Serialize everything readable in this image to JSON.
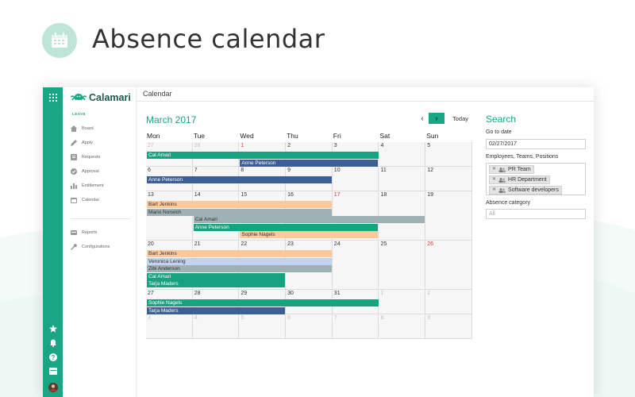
{
  "header": {
    "title": "Absence calendar"
  },
  "brand": {
    "name": "Calamari"
  },
  "sidebar": {
    "section_label": "LEAVE",
    "items": [
      {
        "label": "Board",
        "icon": "home-icon"
      },
      {
        "label": "Apply",
        "icon": "pencil-icon"
      },
      {
        "label": "Requests",
        "icon": "list-icon"
      },
      {
        "label": "Approval",
        "icon": "check-circle-icon"
      },
      {
        "label": "Entitlement",
        "icon": "bar-chart-icon"
      },
      {
        "label": "Calendar",
        "icon": "calendar-icon"
      }
    ],
    "bottom_items": [
      {
        "label": "Reports",
        "icon": "reports-icon"
      },
      {
        "label": "Configurations",
        "icon": "wrench-icon"
      }
    ]
  },
  "topbar": {
    "title": "Calendar"
  },
  "calendar": {
    "month_label": "March 2017",
    "today_label": "Today",
    "prev_label": "‹",
    "next_label": "›",
    "weekdays": [
      "Mon",
      "Tue",
      "Wed",
      "Thu",
      "Fri",
      "Sat",
      "Sun"
    ],
    "weeks": [
      [
        {
          "d": "27",
          "o": true
        },
        {
          "d": "28",
          "o": true
        },
        {
          "d": "1",
          "r": true
        },
        {
          "d": "2"
        },
        {
          "d": "3"
        },
        {
          "d": "4"
        },
        {
          "d": "5"
        }
      ],
      [
        {
          "d": "6"
        },
        {
          "d": "7"
        },
        {
          "d": "8"
        },
        {
          "d": "9"
        },
        {
          "d": "10"
        },
        {
          "d": "11"
        },
        {
          "d": "12"
        }
      ],
      [
        {
          "d": "13"
        },
        {
          "d": "14"
        },
        {
          "d": "15"
        },
        {
          "d": "16"
        },
        {
          "d": "17",
          "r": true
        },
        {
          "d": "18"
        },
        {
          "d": "19"
        }
      ],
      [
        {
          "d": "20"
        },
        {
          "d": "21"
        },
        {
          "d": "22"
        },
        {
          "d": "23"
        },
        {
          "d": "24"
        },
        {
          "d": "25"
        },
        {
          "d": "26",
          "r": true
        }
      ],
      [
        {
          "d": "27"
        },
        {
          "d": "28"
        },
        {
          "d": "29"
        },
        {
          "d": "30"
        },
        {
          "d": "31"
        },
        {
          "d": "1",
          "o": true
        },
        {
          "d": "2",
          "o": true
        }
      ],
      [
        {
          "d": "3",
          "o": true
        },
        {
          "d": "4",
          "o": true
        },
        {
          "d": "5",
          "o": true
        },
        {
          "d": "6",
          "o": true
        },
        {
          "d": "7",
          "o": true
        },
        {
          "d": "8",
          "o": true
        },
        {
          "d": "9",
          "o": true
        }
      ]
    ],
    "absences": [
      {
        "name": "Cal Amari",
        "week": 0,
        "slot": 0,
        "start": 0,
        "span": 5,
        "color": "#17a37f",
        "text": "#ffffff"
      },
      {
        "name": "Anne Peterson",
        "week": 0,
        "slot": 1,
        "start": 2,
        "span": 3,
        "color": "#3c5f95",
        "text": "#ffffff"
      },
      {
        "name": "Anne Peterson",
        "week": 1,
        "slot": 0,
        "start": 0,
        "span": 4,
        "color": "#3c5f95",
        "text": "#ffffff"
      },
      {
        "name": "Bart Jenkins",
        "week": 2,
        "slot": 0,
        "start": 0,
        "span": 4,
        "color": "#fdc89c",
        "text": "#333333"
      },
      {
        "name": "Mario Norwich",
        "week": 2,
        "slot": 1,
        "start": 0,
        "span": 4,
        "color": "#9fb1b4",
        "text": "#333333"
      },
      {
        "name": "Cal Amari",
        "week": 2,
        "slot": 2,
        "start": 1,
        "span": 5,
        "color": "#9fb1b4",
        "text": "#333333"
      },
      {
        "name": "Anne Peterson",
        "week": 2,
        "slot": 3,
        "start": 1,
        "span": 4,
        "color": "#17a37f",
        "text": "#ffffff"
      },
      {
        "name": "Sophie Nagels",
        "week": 2,
        "slot": 4,
        "start": 2,
        "span": 3,
        "color": "#fdc89c",
        "text": "#333333"
      },
      {
        "name": "Bart Jenkins",
        "week": 3,
        "slot": 0,
        "start": 0,
        "span": 4,
        "color": "#fdc89c",
        "text": "#333333"
      },
      {
        "name": "Veronica Lening",
        "week": 3,
        "slot": 1,
        "start": 0,
        "span": 4,
        "color": "#c3d2ee",
        "text": "#333333"
      },
      {
        "name": "Zibi Anderson",
        "week": 3,
        "slot": 2,
        "start": 0,
        "span": 4,
        "color": "#9fb1b4",
        "text": "#333333"
      },
      {
        "name": "Cal Amari",
        "week": 3,
        "slot": 3,
        "start": 0,
        "span": 3,
        "color": "#17a37f",
        "text": "#ffffff"
      },
      {
        "name": "Tarja Maders",
        "week": 3,
        "slot": 4,
        "start": 0,
        "span": 3,
        "color": "#17a37f",
        "text": "#ffffff"
      },
      {
        "name": "Sophie Nagels",
        "week": 4,
        "slot": 0,
        "start": 0,
        "span": 5,
        "color": "#17a37f",
        "text": "#ffffff"
      },
      {
        "name": "Tarja Maders",
        "week": 4,
        "slot": 1,
        "start": 0,
        "span": 3,
        "color": "#3c5f95",
        "text": "#ffffff"
      }
    ]
  },
  "search": {
    "title": "Search",
    "goto_label": "Go to date",
    "goto_value": "02/27/2017",
    "employees_label": "Employees, Teams, Positions",
    "tags": [
      "PR Team",
      "HR Department",
      "Software developers"
    ],
    "category_label": "Absence category",
    "category_placeholder": "All"
  },
  "colors": {
    "accent": "#1aa585",
    "weekend_red": "#d9363e"
  }
}
